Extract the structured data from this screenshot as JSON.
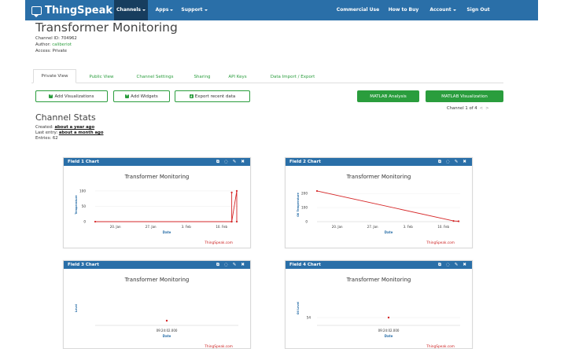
{
  "navbar": {
    "brand": "ThingSpeak",
    "brand_tm": "™",
    "items": [
      {
        "label": "Channels",
        "dropdown": true,
        "active": true
      },
      {
        "label": "Apps",
        "dropdown": true
      },
      {
        "label": "Support",
        "dropdown": true
      },
      {
        "label": "Commercial Use"
      },
      {
        "label": "How to Buy"
      },
      {
        "label": "Account",
        "dropdown": true
      },
      {
        "label": "Sign Out"
      }
    ]
  },
  "page": {
    "title": "Transformer Monitoring",
    "channel_id": "Channel ID: 704962",
    "author_label": "Author: ",
    "author": "caliberiot",
    "access": "Access: Private"
  },
  "tabs": [
    "Private View",
    "Public View",
    "Channel Settings",
    "Sharing",
    "API Keys",
    "Data Import / Export"
  ],
  "buttons": {
    "add_visualizations": "Add Visualizations",
    "add_widgets": "Add Widgets",
    "export_data": "Export recent data",
    "matlab_analysis": "MATLAB Analysis",
    "matlab_visualization": "MATLAB Visualization"
  },
  "pager": {
    "text": "Channel 1 of 4",
    "prev": "<",
    "next": ">"
  },
  "stats": {
    "title": "Channel Stats",
    "created_label": "Created: ",
    "created": "about a year ago",
    "last_entry_label": "Last entry: ",
    "last_entry": "about a month ago",
    "entries": "Entries: 62"
  },
  "panel_tools": [
    "external-link-icon",
    "comment-icon",
    "pencil-icon",
    "close-icon"
  ],
  "colors": {
    "navbar": "#2a6fa8",
    "navbar_active": "#173d5e",
    "green": "#2a9d3d",
    "series": "#d62728"
  },
  "charts": [
    {
      "heading": "Field 1 Chart",
      "title": "Transformer Monitoring",
      "ylabel": "Temperature",
      "xlabel": "Date",
      "credit": "ThingSpeak.com"
    },
    {
      "heading": "Field 2 Chart",
      "title": "Transformer Monitoring",
      "ylabel": "Oil Temperature",
      "xlabel": "Date",
      "credit": "ThingSpeak.com"
    },
    {
      "heading": "Field 3 Chart",
      "title": "Transformer Monitoring",
      "ylabel": "Level",
      "xlabel": "Date",
      "credit": "ThingSpeak.com"
    },
    {
      "heading": "Field 4 Chart",
      "title": "Transformer Monitoring",
      "ylabel": "Oil Level",
      "xlabel": "Date",
      "credit": "ThingSpeak.com"
    }
  ],
  "chart_data": [
    {
      "type": "line",
      "title": "Transformer Monitoring",
      "xlabel": "Date",
      "ylabel": "Temperature",
      "x_ticks": [
        "20. Jan",
        "27. Jan",
        "3. Feb",
        "10. Feb"
      ],
      "y_ticks": [
        0,
        50,
        100
      ],
      "ylim": [
        0,
        110
      ],
      "x_range": [
        "2019-01-16",
        "2019-02-13"
      ],
      "series": [
        {
          "x": [
            "2019-01-16",
            "2019-02-12",
            "2019-02-12",
            "2019-02-12",
            "2019-02-13",
            "2019-02-13"
          ],
          "values": [
            0,
            0,
            95,
            0,
            100,
            0
          ]
        }
      ]
    },
    {
      "type": "line",
      "title": "Transformer Monitoring",
      "xlabel": "Date",
      "ylabel": "Oil Temperature",
      "x_ticks": [
        "20. Jan",
        "27. Jan",
        "3. Feb",
        "10. Feb"
      ],
      "y_ticks": [
        0,
        100,
        200
      ],
      "ylim": [
        0,
        240
      ],
      "x_range": [
        "2019-01-16",
        "2019-02-13"
      ],
      "series": [
        {
          "x": [
            "2019-01-16",
            "2019-02-12",
            "2019-02-13"
          ],
          "values": [
            218,
            5,
            3
          ]
        }
      ]
    },
    {
      "type": "scatter",
      "title": "Transformer Monitoring",
      "xlabel": "Date",
      "ylabel": "Level",
      "x_ticks": [
        "09:24:02.000"
      ],
      "y_ticks": [],
      "series": [
        {
          "x": [
            "09:24:02.000"
          ],
          "values": [
            0
          ]
        }
      ]
    },
    {
      "type": "scatter",
      "title": "Transformer Monitoring",
      "xlabel": "Date",
      "ylabel": "Oil Level",
      "x_ticks": [
        "09:24:02.000"
      ],
      "y_ticks": [
        54
      ],
      "series": [
        {
          "x": [
            "09:24:02.000"
          ],
          "values": [
            54
          ]
        }
      ]
    }
  ]
}
